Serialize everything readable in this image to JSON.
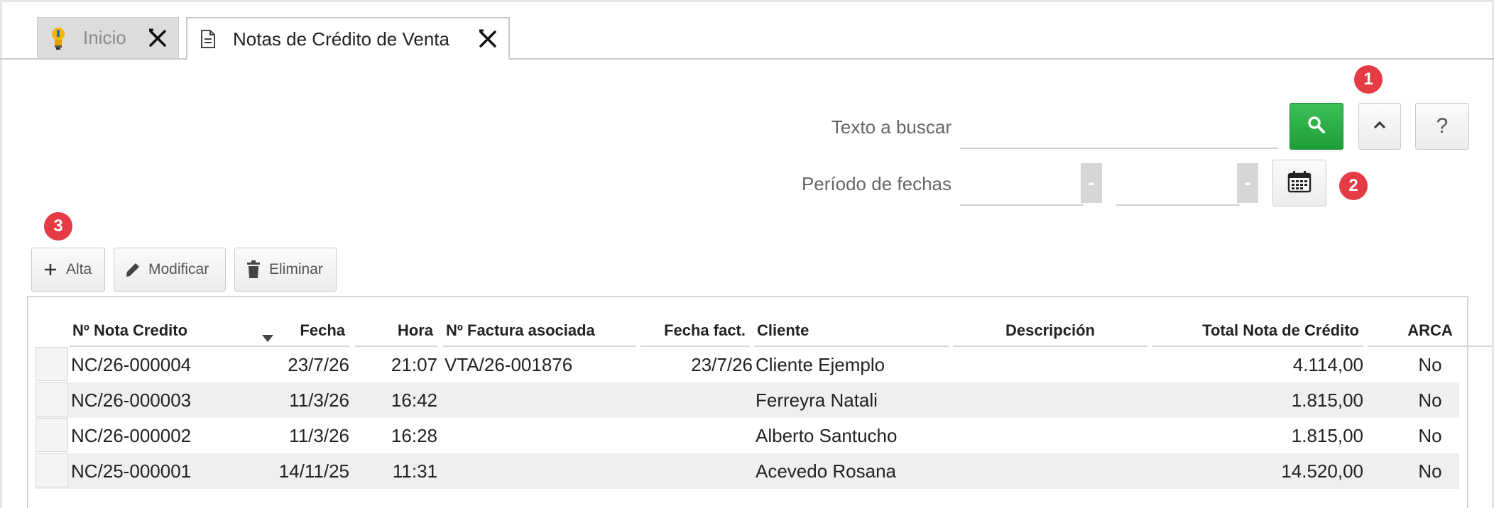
{
  "tabs": [
    {
      "label": "Inicio",
      "icon": "lightbulb-icon",
      "active": false
    },
    {
      "label": "Notas de Crédito de Venta",
      "icon": "document-icon",
      "active": true
    }
  ],
  "search": {
    "text_label": "Texto a buscar",
    "text_value": "",
    "period_label": "Período de fechas",
    "date_from": "",
    "date_to": "",
    "dash": "-"
  },
  "buttons": {
    "help": "?",
    "add": "Alta",
    "edit": "Modificar",
    "delete": "Eliminar"
  },
  "badges": [
    "1",
    "2",
    "3"
  ],
  "colors": {
    "search_button": "#27a844",
    "badge": "#e53b45",
    "alt_row": "#efefef"
  },
  "table": {
    "columns": [
      "Nº Nota Credito",
      "Fecha",
      "Hora",
      "Nº Factura asociada",
      "Fecha fact.",
      "Cliente",
      "Descripción",
      "Total Nota de Crédito",
      "ARCA"
    ],
    "rows": [
      [
        "NC/26-000004",
        "23/7/26",
        "21:07",
        "VTA/26-001876",
        "23/7/26",
        "Cliente Ejemplo",
        "",
        "4.114,00",
        "No"
      ],
      [
        "NC/26-000003",
        "11/3/26",
        "16:42",
        "",
        "",
        "Ferreyra Natali",
        "",
        "1.815,00",
        "No"
      ],
      [
        "NC/26-000002",
        "11/3/26",
        "16:28",
        "",
        "",
        "Alberto Santucho",
        "",
        "1.815,00",
        "No"
      ],
      [
        "NC/25-000001",
        "14/11/25",
        "11:31",
        "",
        "",
        "Acevedo Rosana",
        "",
        "14.520,00",
        "No"
      ]
    ]
  }
}
